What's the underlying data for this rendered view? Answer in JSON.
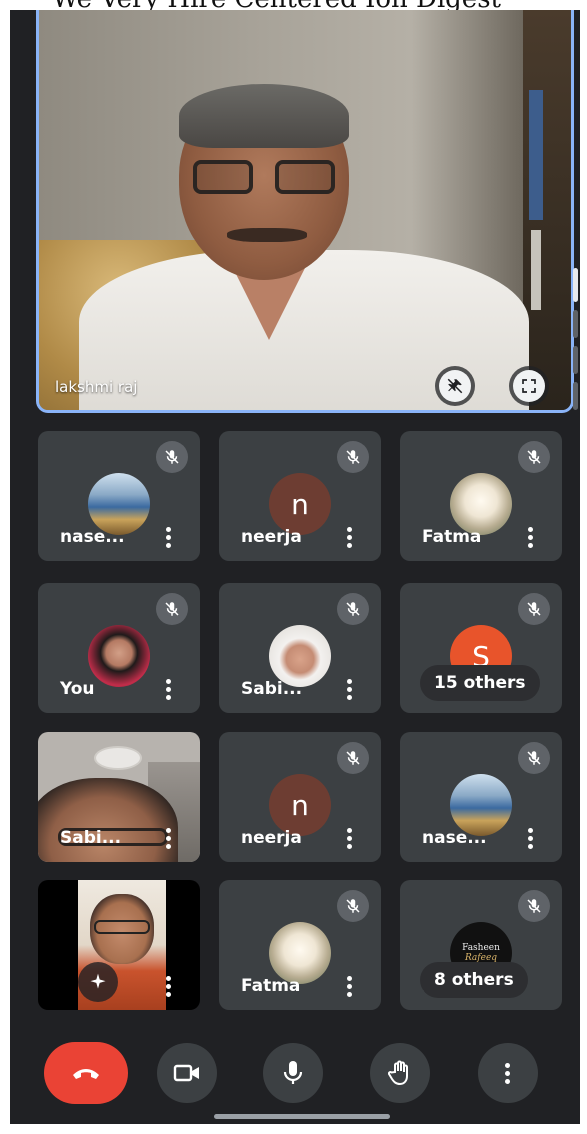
{
  "caption_fragment": "We Very Hire Centered Ion Digest",
  "main_speaker": {
    "name": "lakshmi raj"
  },
  "tiles": [
    {
      "name": "nase...",
      "type": "photo",
      "avatar": "books-photo"
    },
    {
      "name": "neerja",
      "type": "letter",
      "letter": "n",
      "color": "#6d3d32"
    },
    {
      "name": "Fatma",
      "type": "photo",
      "avatar": "rose-photo"
    },
    {
      "name": "You",
      "type": "photo",
      "avatar": "woman-photo"
    },
    {
      "name": "Sabi...",
      "type": "photo",
      "avatar": "hijab-photo"
    },
    {
      "name": "S",
      "type": "others",
      "letter": "S",
      "color": "#e8542b",
      "others_label": "15 others"
    },
    {
      "name": "Sabi...",
      "type": "video"
    },
    {
      "name": "neerja",
      "type": "letter",
      "letter": "n",
      "color": "#6d3d32"
    },
    {
      "name": "nase...",
      "type": "photo",
      "avatar": "books-photo"
    },
    {
      "name": "",
      "type": "video2"
    },
    {
      "name": "Fatma",
      "type": "photo",
      "avatar": "rose-photo"
    },
    {
      "name": "F",
      "type": "others2",
      "logo_line1": "Fasheen",
      "logo_line2": "Rafeeq",
      "others_label": "8 others"
    }
  ],
  "controls": {
    "end_call": "end-call",
    "camera": "camera",
    "mic": "microphone",
    "raise_hand": "raise-hand",
    "more": "more-options"
  },
  "colors": {
    "background": "#202124",
    "tile": "#3c4043",
    "end_call": "#ea4335",
    "speaker_border": "#8ab4f8"
  }
}
